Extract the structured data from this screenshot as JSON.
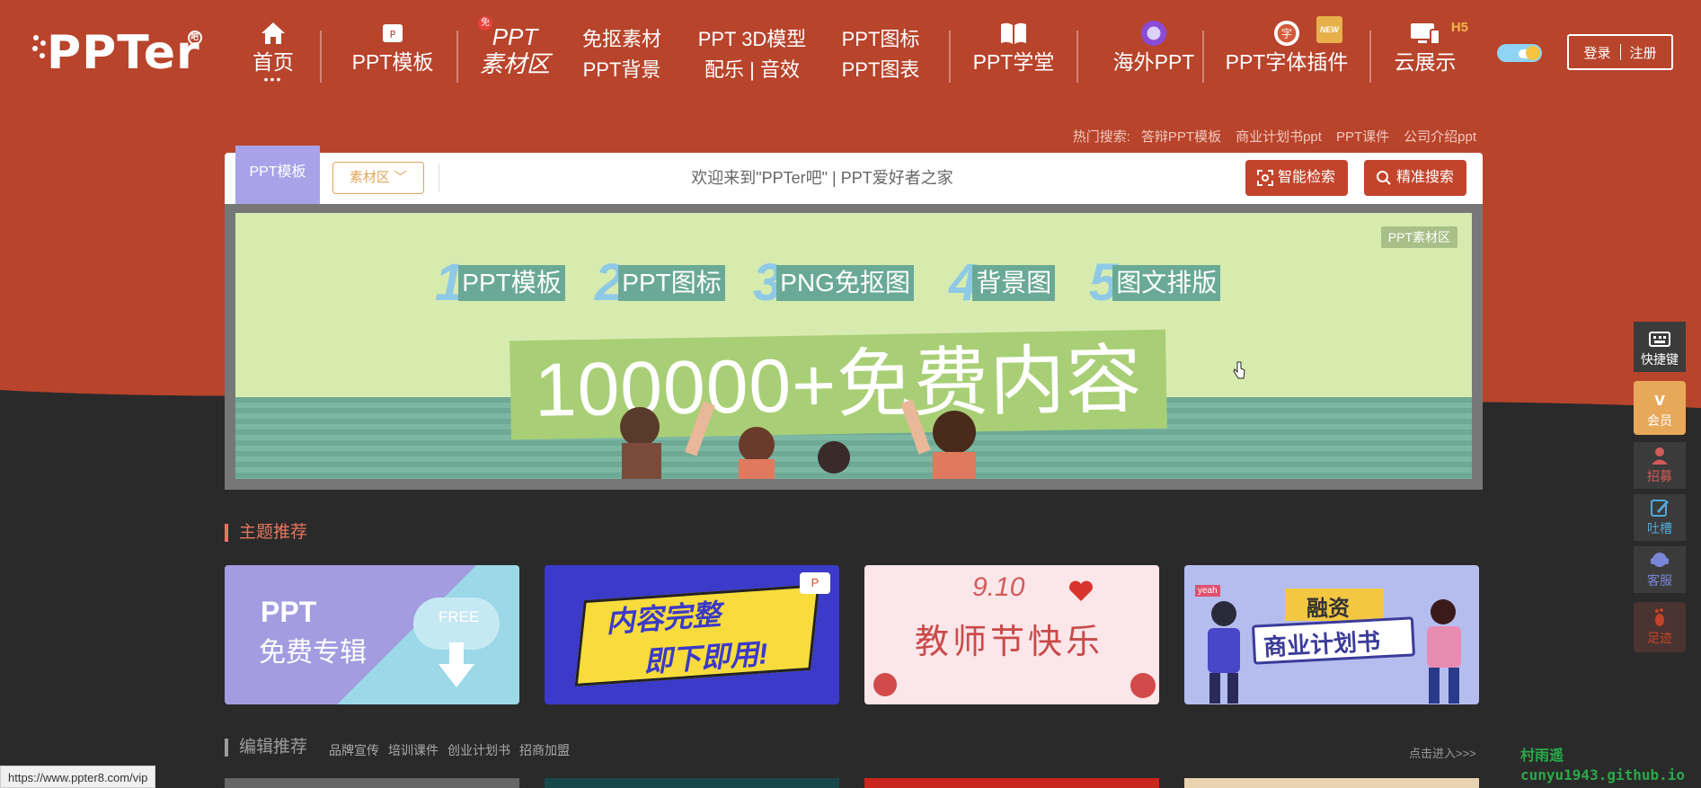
{
  "nav": {
    "logo": "PPTer",
    "home": "首页",
    "ppt_template": "PPT模板",
    "material_line1": "PPT",
    "material_line2": "素材区",
    "free_badge": "免",
    "cutout": "免抠素材",
    "background": "PPT背景",
    "model3d": "PPT 3D模型",
    "music": "配乐 | 音效",
    "icons": "PPT图标",
    "charts": "PPT图表",
    "school": "PPT学堂",
    "overseas": "海外PPT",
    "font_plugin": "PPT字体插件",
    "new_badge": "NEW",
    "cloud": "云展示",
    "h5_badge": "H5",
    "login": "登录",
    "register": "注册"
  },
  "hot_search": {
    "label": "热门搜索:",
    "items": [
      "答辩PPT模板",
      "商业计划书ppt",
      "PPT课件",
      "公司介绍ppt"
    ]
  },
  "search": {
    "tab": "PPT模板",
    "dropdown": "素材区",
    "placeholder": "欢迎来到\"PPTer吧\" | PPT爱好者之家",
    "smart_btn": "智能检索",
    "precise_btn": "精准搜索"
  },
  "banner": {
    "tag": "PPT素材区",
    "features": [
      {
        "num": "1",
        "label": "PPT模板"
      },
      {
        "num": "2",
        "label": "PPT图标"
      },
      {
        "num": "3",
        "label": "PNG免抠图"
      },
      {
        "num": "4",
        "label": "背景图"
      },
      {
        "num": "5",
        "label": "图文排版"
      }
    ],
    "headline": "100000+免费内容"
  },
  "theme": {
    "title": "主题推荐",
    "cards": [
      {
        "line1": "PPT",
        "line2": "免费专辑",
        "extra": "FREE"
      },
      {
        "line1": "内容完整",
        "line2": "即下即用!"
      },
      {
        "line1": "9.10",
        "line2": "教师节快乐"
      },
      {
        "line1": "融资",
        "line2": "商业计划书",
        "extra": "yeah"
      }
    ]
  },
  "editor": {
    "title": "编辑推荐",
    "tags": [
      "品牌宣传",
      "培训课件",
      "创业计划书",
      "招商加盟"
    ],
    "enter": "点击进入>>>"
  },
  "float_bar": {
    "shortcut": "快捷键",
    "vip": "会员",
    "recruit": "招募",
    "feedback": "吐槽",
    "service": "客服",
    "footprint": "足迹"
  },
  "status_url": "https://www.ppter8.com/vip",
  "watermark_line1": "村雨遥",
  "watermark_line2": "cunyu1943.github.io"
}
